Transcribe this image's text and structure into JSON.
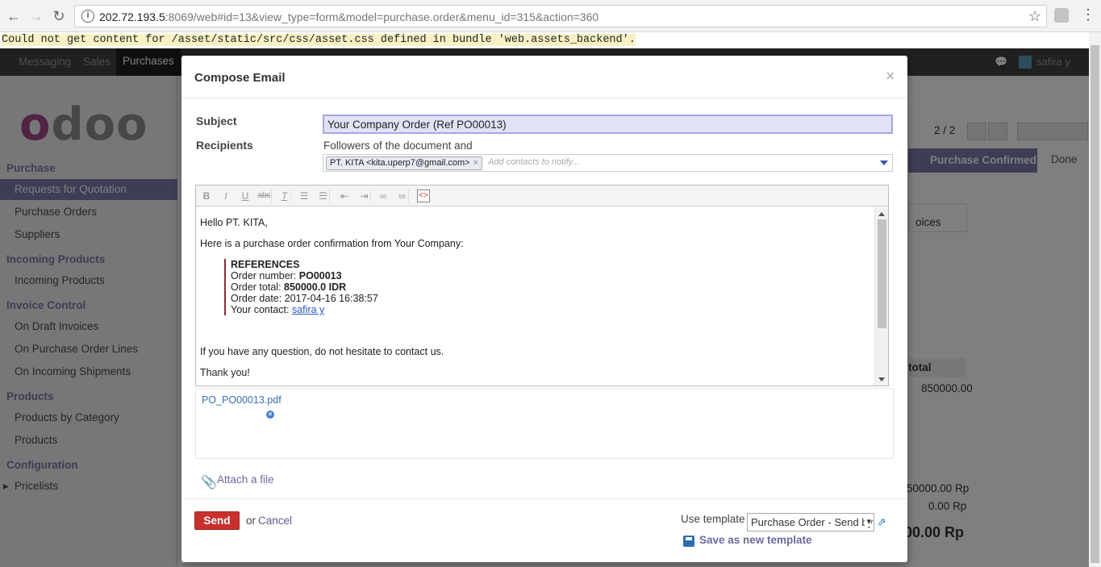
{
  "browser": {
    "url_host": "202.72.193.5",
    "url_rest": ":8069/web#id=13&view_type=form&model=purchase.order&menu_id=315&action=360"
  },
  "error_message": "Could not get content for /asset/static/src/css/asset.css defined in bundle 'web.assets_backend'.",
  "topnav": {
    "items": [
      "Messaging",
      "Sales",
      "Purchases"
    ],
    "active": "Purchases",
    "user": "safira y"
  },
  "sidebar": {
    "logo": "odoo",
    "sections": [
      {
        "title": "Purchase",
        "items": [
          "Requests for Quotation",
          "Purchase Orders",
          "Suppliers"
        ]
      },
      {
        "title": "Incoming Products",
        "items": [
          "Incoming Products"
        ]
      },
      {
        "title": "Invoice Control",
        "items": [
          "On Draft Invoices",
          "On Purchase Order Lines",
          "On Incoming Shipments"
        ]
      },
      {
        "title": "Products",
        "items": [
          "Products by Category",
          "Products"
        ]
      },
      {
        "title": "Configuration",
        "items": [
          "Pricelists"
        ]
      }
    ],
    "active_item": "Requests for Quotation"
  },
  "background": {
    "pager": "2 / 2",
    "status_active": "Purchase Confirmed",
    "status_next": "Done",
    "invoices_fragment": "oices",
    "table_header": "total",
    "row_value": "850000.00",
    "untaxed": "50000.00 Rp",
    "taxes": "0.00 Rp",
    "grand_total": "00.00 Rp"
  },
  "modal": {
    "title": "Compose Email",
    "close": "×",
    "subject_label": "Subject",
    "subject_value": "Your Company Order (Ref PO00013)",
    "recipients_label": "Recipients",
    "followers_text": "Followers of the document and",
    "recipient_tag": "PT. KITA <kita.uperp7@gmail.com>",
    "recipient_placeholder": "Add contacts to notify...",
    "body": {
      "greeting": "Hello PT. KITA,",
      "intro": "Here is a purchase order confirmation from Your Company:",
      "references_title": "REFERENCES",
      "order_number_label": "Order number: ",
      "order_number": "PO00013",
      "order_total_label": "Order total: ",
      "order_total": "850000.0 IDR",
      "order_date_label": "Order date: ",
      "order_date": "2017-04-16 16:38:57",
      "contact_label": "Your contact: ",
      "contact": "safira y",
      "question": "If you have any question, do not hesitate to contact us.",
      "thanks": "Thank you!"
    },
    "attachment": "PO_PO00013.pdf",
    "attach_file": "Attach a file",
    "send": "Send",
    "or": "or",
    "cancel": "Cancel",
    "use_template_label": "Use template",
    "template_value": "Purchase Order - Send by Email",
    "save_template": "Save as new template"
  }
}
